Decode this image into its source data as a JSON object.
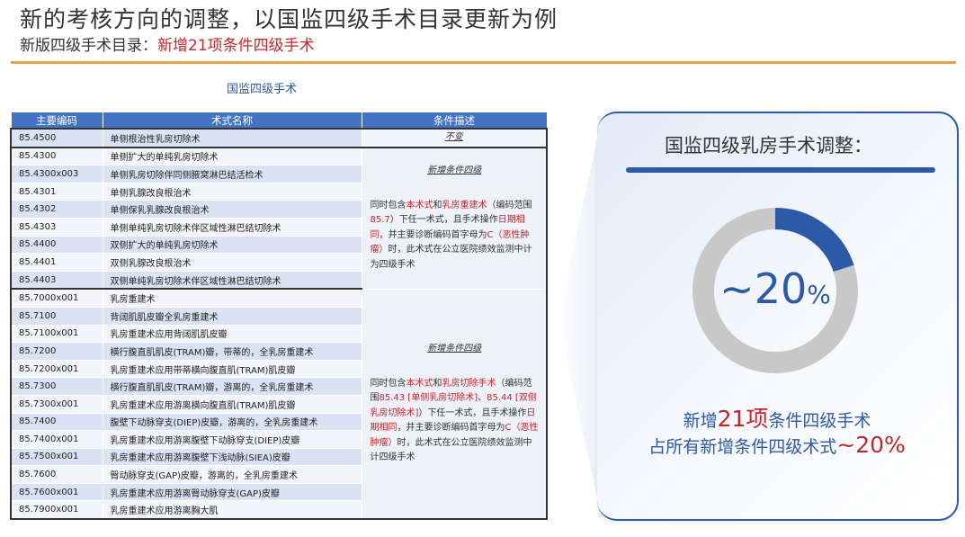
{
  "header": {
    "title": "新的考核方向的调整，以国监四级手术目录更新为例",
    "subtitle_prefix": "新版四级手术目录：",
    "subtitle_highlight": "新增21项条件四级手术"
  },
  "table": {
    "caption": "国监四级手术",
    "headers": [
      "主要编码",
      "术式名称",
      "条件描述"
    ],
    "rows": [
      {
        "code": "85.4500",
        "name": "单侧根治性乳房切除术"
      },
      {
        "code": "85.4300",
        "name": "单侧扩大的单纯乳房切除术"
      },
      {
        "code": "85.4300x003",
        "name": "单侧乳房切除伴同侧腋窝淋巴结活检术"
      },
      {
        "code": "85.4301",
        "name": "单侧乳腺改良根治术"
      },
      {
        "code": "85.4302",
        "name": "单侧保乳乳腺改良根治术"
      },
      {
        "code": "85.4303",
        "name": "单侧单纯乳房切除术伴区域性淋巴结切除术"
      },
      {
        "code": "85.4400",
        "name": "双侧扩大的单纯乳房切除术"
      },
      {
        "code": "85.4401",
        "name": "双侧乳腺改良根治术"
      },
      {
        "code": "85.4403",
        "name": "双侧单纯乳房切除术伴区域性淋巴结切除术"
      },
      {
        "code": "85.7000x001",
        "name": "乳房重建术"
      },
      {
        "code": "85.7100",
        "name": "背阔肌肌皮瓣全乳房重建术"
      },
      {
        "code": "85.7100x001",
        "name": "乳房重建术应用背阔肌肌皮瓣"
      },
      {
        "code": "85.7200",
        "name": "横行腹直肌肌皮(TRAM)瓣，带蒂的，全乳房重建术"
      },
      {
        "code": "85.7200x001",
        "name": "乳房重建术应用带蒂横向腹直肌(TRAM)肌皮瓣"
      },
      {
        "code": "85.7300",
        "name": "横行腹直肌肌皮(TRAM)瓣，游离的，全乳房重建术"
      },
      {
        "code": "85.7300x001",
        "name": "乳房重建术应用游离横向腹直肌(TRAM)肌皮瓣"
      },
      {
        "code": "85.7400",
        "name": "腹壁下动脉穿支(DIEP)皮瓣，游离的，全乳房重建术"
      },
      {
        "code": "85.7400x001",
        "name": "乳房重建术应用游离腹壁下动脉穿支(DIEP)皮瓣"
      },
      {
        "code": "85.7500x001",
        "name": "乳房重建术应用游离腹壁下浅动脉(SIEA)皮瓣"
      },
      {
        "code": "85.7600",
        "name": "臀动脉穿支(GAP)皮瓣，游离的，全乳房重建术"
      },
      {
        "code": "85.7600x001",
        "name": "乳房重建术应用游离臀动脉穿支(GAP)皮瓣"
      },
      {
        "code": "85.7900x001",
        "name": "乳房重建术应用游离胸大肌"
      }
    ],
    "cond_unchanged": "不变",
    "cond_group1": {
      "title": "新增条件四级",
      "t1": "同时包含",
      "r1": "本术式",
      "t2": "和",
      "r2": "乳房重建术",
      "t3": "（编码范围",
      "r3": "85.7",
      "t4": "）下任一术式，且手术操作",
      "r4": "日期相同",
      "t5": "，并主要诊断编码首字母为",
      "r5": "C（恶性肿瘤）",
      "t6": "时，此术式在公立医院绩效监测中计为四级手术"
    },
    "cond_group2": {
      "title": "新增条件四级",
      "t1": "同时包含",
      "r1": "本术式",
      "t2": "和",
      "r2": "乳房切除手术",
      "t3": "（编码范围",
      "r3": "85.43 [单侧乳房切除术]",
      "t4": "、",
      "r4": "85.44 [双侧乳房切除术]",
      "t5": "）下任一术式，且手术操作",
      "r5": "日期相同",
      "t6": "，并主要诊断编码首字母为",
      "r6": "C（恶性肿瘤）",
      "t7": "时，此术式在公立医院绩效监测中计四级手术"
    }
  },
  "card": {
    "title": "国监四级乳房手术调整：",
    "donut_value": "~20",
    "donut_unit": "%",
    "donut_fraction": 0.2,
    "line1_pre": "新增",
    "line1_num": "21项",
    "line1_post": "条件四级手术",
    "line2_pre": "占所有新增条件四级术式",
    "line2_num": "~20%",
    "colors": {
      "accent": "#2d5aa8",
      "ring": "#c8c8c8",
      "highlight": "#c0282d"
    }
  }
}
